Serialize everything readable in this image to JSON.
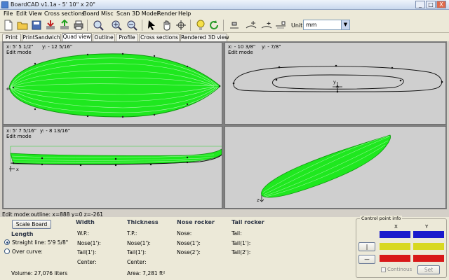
{
  "window": {
    "title": "BoardCAD v1.1a -   5' 10\" x 20\"",
    "buttons": {
      "minimize": "_",
      "maximize": "□",
      "close": "X"
    }
  },
  "menu": [
    "File",
    "Edit",
    "View",
    "Cross sections",
    "Board",
    "Misc",
    "Scan",
    "3D Model",
    "Render",
    "Help"
  ],
  "toolbar": {
    "icons": [
      "new-file-icon",
      "open-file-icon",
      "save-file-icon",
      "import-icon",
      "export-icon",
      "print-icon",
      "zoom-icon",
      "zoom-in-icon",
      "zoom-out-icon",
      "select-arrow-icon",
      "pan-hand-icon",
      "move-icon",
      "lightbulb-icon",
      "refresh-icon",
      "align-icon",
      "add-point-icon",
      "add-point-alt-icon",
      "add-guide-icon"
    ],
    "unit_label": "Unit:",
    "unit_value": "mm"
  },
  "tabs": [
    "Print",
    "PrintSandwich",
    "Quad view",
    "Outline",
    "Profile",
    "Cross sections",
    "Rendered 3D view"
  ],
  "active_tab": "Quad view",
  "views": {
    "top_left": {
      "x": "x: 5' 5 1/2\"",
      "y": "y: - 12 5/16\"",
      "mode": "Edit mode"
    },
    "top_right": {
      "x": "x: - 10 3/8\"",
      "y": "y: - 7/8\"",
      "mode": "Edit mode"
    },
    "bottom_left": {
      "x": "x: 5' 7 5/16\"",
      "y": "y: - 8 13/16\"",
      "mode": "Edit mode"
    },
    "axis_y": "y",
    "axis_z": "z",
    "axis_x": "x"
  },
  "status": "Edit mode:outline: x=888 y=0 z=-261",
  "bottom": {
    "scale_button": "Scale Board",
    "length_header": "Length",
    "straight_line": "Straight line: 5'9 5/8\"",
    "over_curve": "Over curve:",
    "volume": "Volume: 27,076 liters",
    "width_header": "Width",
    "width_rows": [
      "W.P.:",
      "Nose(1'):",
      "Tail(1'):",
      "Center:"
    ],
    "thickness_header": "Thickness",
    "thickness_rows": [
      "T.P.:",
      "Nose(1'):",
      "Tail(1'):",
      "Center:"
    ],
    "area": "Area: 7,281 ft²",
    "nose_rocker_header": "Nose rocker",
    "nose_rocker_rows": [
      "Nose:",
      "Nose(1'):",
      "Nose(2'):"
    ],
    "tail_rocker_header": "Tail rocker",
    "tail_rocker_rows": [
      "Tail:",
      "Tail(1'):",
      "Tail(2'):"
    ]
  },
  "control_point": {
    "legend": "Control point info",
    "col_x": "X",
    "col_y": "Y",
    "colors": [
      "#1a1acc",
      "#d8d820",
      "#d81818"
    ],
    "btn_up": "|",
    "btn_down": "—",
    "continous": "Continous",
    "set": "Set"
  },
  "colors": {
    "wireframe": "#19e619",
    "pane_bg": "#cfcfcf"
  }
}
